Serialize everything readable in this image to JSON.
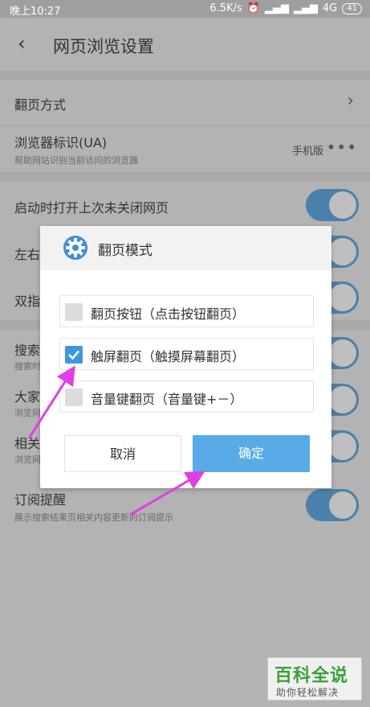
{
  "status_bar": {
    "time": "晚上10:27",
    "speed": "6.5K/s",
    "network": "4G",
    "battery": "41"
  },
  "header": {
    "back_icon": "chevron-left-icon",
    "title": "网页浏览设置"
  },
  "settings": [
    {
      "label": "翻页方式"
    },
    {
      "label": "浏览器标识(UA)",
      "sub": "帮助网站识别当前访问的浏览器",
      "value": "手机版"
    },
    {
      "label": "启动时打开上次未关闭网页"
    },
    {
      "label": "左右"
    },
    {
      "label": "双指"
    },
    {
      "label": "搜索",
      "sub": "搜索时"
    },
    {
      "label": "大家",
      "sub": "浏览网"
    },
    {
      "label": "相关",
      "sub": "浏览网"
    },
    {
      "label": "订阅提醒",
      "sub": "展示搜索结果页相关内容更新的订阅提示"
    }
  ],
  "dialog": {
    "title": "翻页模式",
    "icon": "gear-icon",
    "options": [
      {
        "label": "翻页按钮（点击按钮翻页）",
        "checked": false
      },
      {
        "label": "触屏翻页（触摸屏幕翻页）",
        "checked": true
      },
      {
        "label": "音量键翻页（音量键+－）",
        "checked": false
      }
    ],
    "cancel": "取消",
    "ok": "确定"
  },
  "watermark": {
    "big": "百科全说",
    "small": "助你轻松解决"
  },
  "colors": {
    "accent": "#58abe6",
    "toggle": "#4a80a9",
    "arrow": "#e13ee6"
  }
}
